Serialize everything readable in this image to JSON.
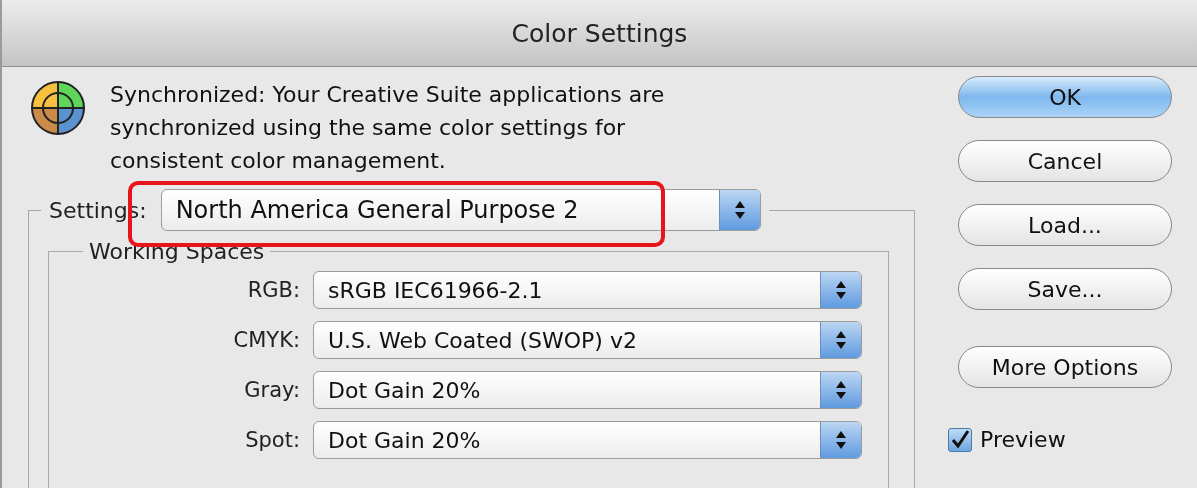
{
  "window": {
    "title": "Color Settings"
  },
  "message": "Synchronized: Your Creative Suite applications are synchronized using the same color settings for consistent color management.",
  "settings": {
    "label": "Settings:",
    "value": "North America General Purpose 2",
    "highlighted": true
  },
  "working_spaces": {
    "title": "Working Spaces",
    "rows": [
      {
        "label": "RGB:",
        "value": "sRGB IEC61966-2.1"
      },
      {
        "label": "CMYK:",
        "value": "U.S. Web Coated (SWOP) v2"
      },
      {
        "label": "Gray:",
        "value": "Dot Gain 20%"
      },
      {
        "label": "Spot:",
        "value": "Dot Gain 20%"
      }
    ]
  },
  "buttons": [
    {
      "label": "OK",
      "default": true
    },
    {
      "label": "Cancel",
      "default": false
    },
    {
      "label": "Load...",
      "default": false
    },
    {
      "label": "Save...",
      "default": false
    },
    {
      "label": "More Options",
      "default": false
    }
  ],
  "preview": {
    "label": "Preview",
    "checked": true
  }
}
